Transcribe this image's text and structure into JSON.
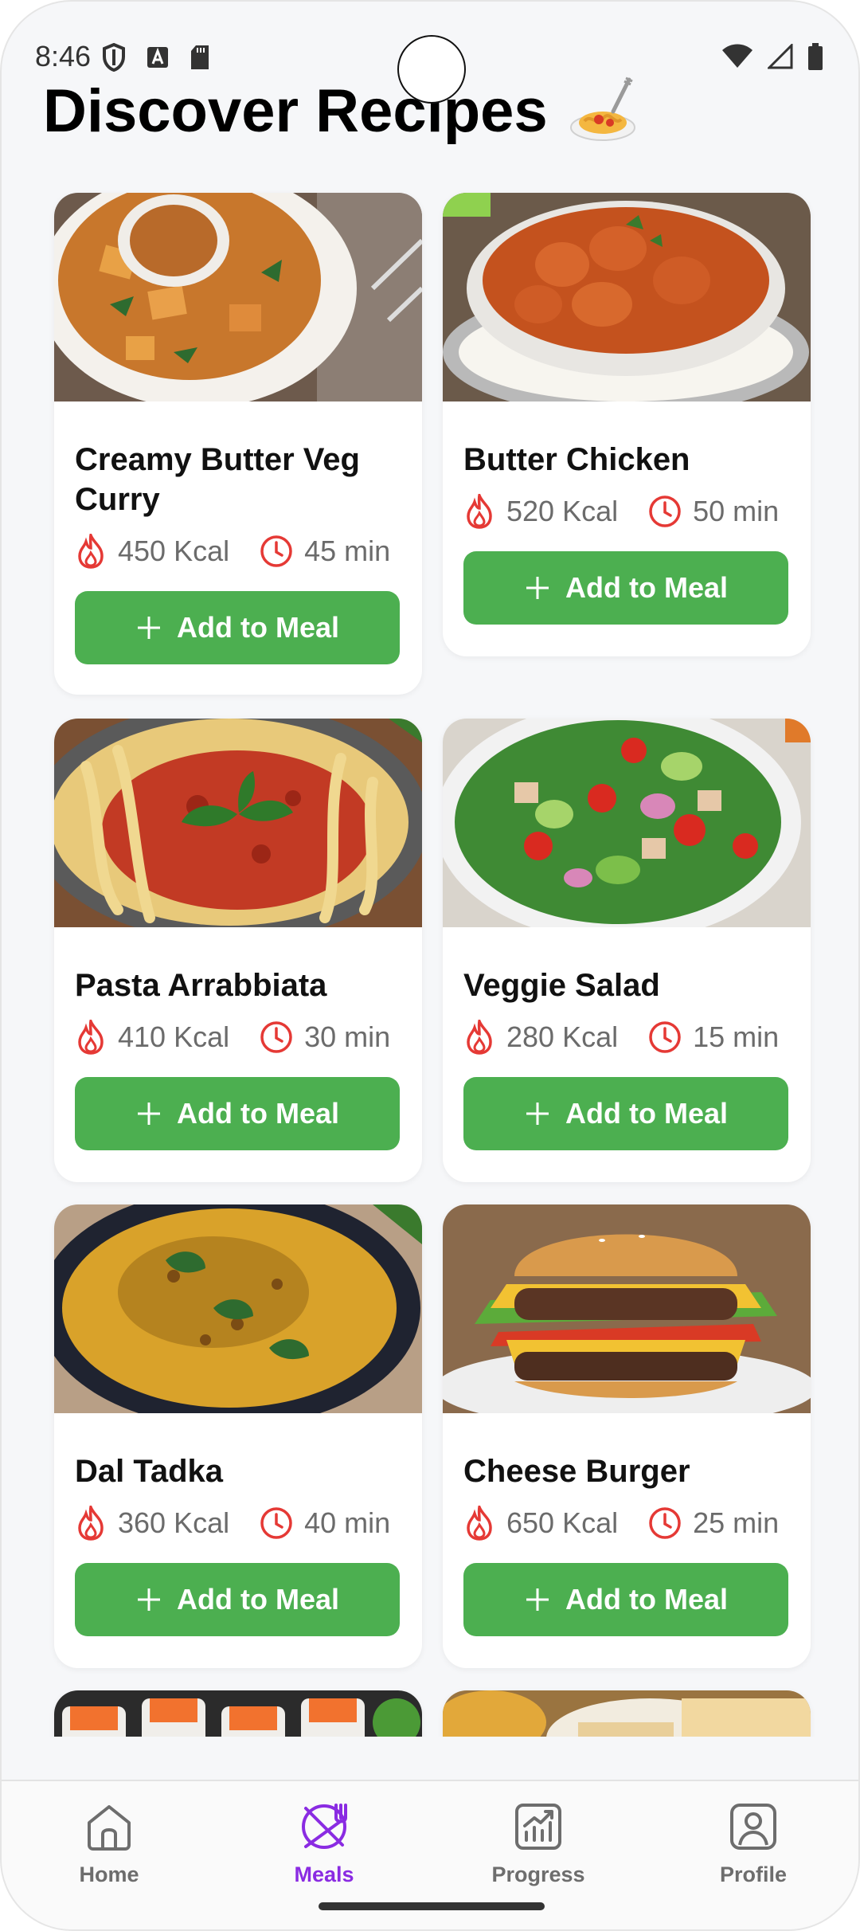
{
  "status": {
    "time": "8:46"
  },
  "page": {
    "title": "Discover Recipes"
  },
  "recipes": [
    {
      "name": "Creamy Butter Veg Curry",
      "kcal": "450 Kcal",
      "time": "45 min",
      "button": "Add to Meal",
      "image": "veg-curry-photo"
    },
    {
      "name": "Butter Chicken",
      "kcal": "520 Kcal",
      "time": "50 min",
      "button": "Add to Meal",
      "image": "butter-chicken-photo"
    },
    {
      "name": "Pasta Arrabbiata",
      "kcal": "410 Kcal",
      "time": "30 min",
      "button": "Add to Meal",
      "image": "pasta-photo"
    },
    {
      "name": "Veggie Salad",
      "kcal": "280 Kcal",
      "time": "15 min",
      "button": "Add to Meal",
      "image": "salad-photo"
    },
    {
      "name": "Dal Tadka",
      "kcal": "360 Kcal",
      "time": "40 min",
      "button": "Add to Meal",
      "image": "dal-tadka-photo"
    },
    {
      "name": "Cheese Burger",
      "kcal": "650 Kcal",
      "time": "25 min",
      "button": "Add to Meal",
      "image": "burger-photo"
    }
  ],
  "nav": {
    "items": [
      {
        "label": "Home",
        "icon": "home-icon"
      },
      {
        "label": "Meals",
        "icon": "meals-icon",
        "active": true
      },
      {
        "label": "Progress",
        "icon": "progress-icon"
      },
      {
        "label": "Profile",
        "icon": "profile-icon"
      }
    ]
  },
  "colors": {
    "accent_green": "#4caf50",
    "accent_red": "#e53935",
    "nav_active": "#8a2be2"
  }
}
